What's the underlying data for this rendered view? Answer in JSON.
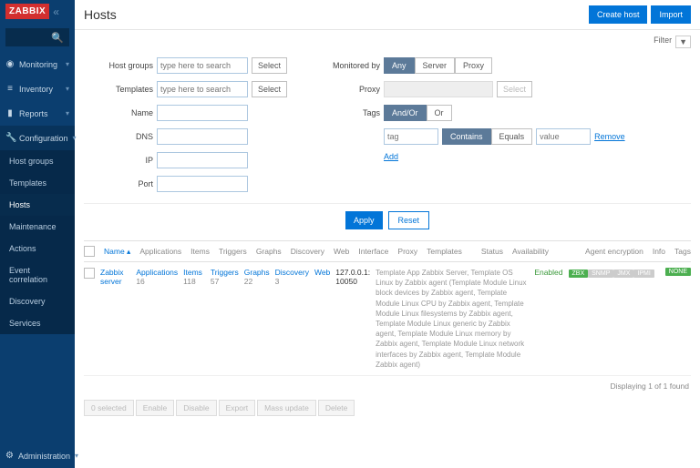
{
  "brand": "ZABBIX",
  "page_title": "Hosts",
  "top_actions": {
    "create": "Create host",
    "import": "Import"
  },
  "filter_label": "Filter",
  "nav": {
    "monitoring": "Monitoring",
    "inventory": "Inventory",
    "reports": "Reports",
    "configuration": "Configuration",
    "administration": "Administration"
  },
  "config_sub": {
    "host_groups": "Host groups",
    "templates": "Templates",
    "hosts": "Hosts",
    "maintenance": "Maintenance",
    "actions": "Actions",
    "event_correlation": "Event correlation",
    "discovery": "Discovery",
    "services": "Services"
  },
  "filters": {
    "host_groups": "Host groups",
    "templates": "Templates",
    "name": "Name",
    "dns": "DNS",
    "ip": "IP",
    "port": "Port",
    "placeholder": "type here to search",
    "select": "Select",
    "monitored_by": "Monitored by",
    "any": "Any",
    "server": "Server",
    "proxy_opt": "Proxy",
    "proxy": "Proxy",
    "tags": "Tags",
    "andor": "And/Or",
    "or": "Or",
    "tag_ph": "tag",
    "contains": "Contains",
    "equals": "Equals",
    "value_ph": "value",
    "remove": "Remove",
    "add": "Add",
    "apply": "Apply",
    "reset": "Reset"
  },
  "headers": {
    "name": "Name",
    "applications": "Applications",
    "items": "Items",
    "triggers": "Triggers",
    "graphs": "Graphs",
    "discovery": "Discovery",
    "web": "Web",
    "interface": "Interface",
    "proxy": "Proxy",
    "templates": "Templates",
    "status": "Status",
    "availability": "Availability",
    "agent_encryption": "Agent encryption",
    "info": "Info",
    "tags": "Tags"
  },
  "row": {
    "name": "Zabbix server",
    "apps_lbl": "Applications",
    "apps_n": "16",
    "items_lbl": "Items",
    "items_n": "118",
    "trig_lbl": "Triggers",
    "trig_n": "57",
    "graph_lbl": "Graphs",
    "graph_n": "22",
    "disc_lbl": "Discovery",
    "disc_n": "3",
    "web_lbl": "Web",
    "iface": "127.0.0.1: 10050",
    "templates": "Template App Zabbix Server, Template OS Linux by Zabbix agent (Template Module Linux block devices by Zabbix agent, Template Module Linux CPU by Zabbix agent, Template Module Linux filesystems by Zabbix agent, Template Module Linux generic by Zabbix agent, Template Module Linux memory by Zabbix agent, Template Module Linux network interfaces by Zabbix agent, Template Module Zabbix agent)",
    "status": "Enabled",
    "avail": {
      "zbx": "ZBX",
      "snmp": "SNMP",
      "jmx": "JMX",
      "ipmi": "IPMI"
    },
    "enc": "NONE"
  },
  "footer": "Displaying 1 of 1 found",
  "bulk": {
    "selected": "0 selected",
    "enable": "Enable",
    "disable": "Disable",
    "export": "Export",
    "mass": "Mass update",
    "delete": "Delete"
  }
}
